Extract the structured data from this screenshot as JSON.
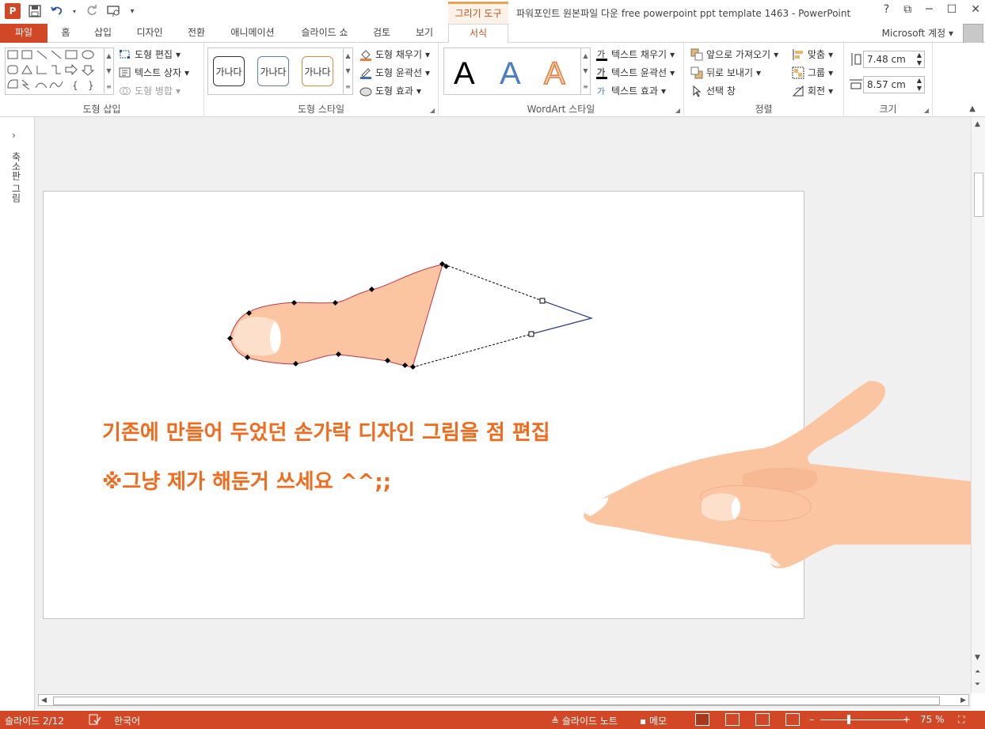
{
  "app": {
    "title": "파워포인트 원본파일 다운 free powerpoint ppt template 1463 - PowerPoint",
    "context_group": "그리기 도구",
    "account": "Microsoft 계정",
    "logo": "P",
    "accent_color": "#d24726"
  },
  "quick_access": [
    "save-icon",
    "undo-icon",
    "redo-icon",
    "present-icon",
    "customize-icon"
  ],
  "window_buttons": [
    "?",
    "⧉",
    "─",
    "☐",
    "✕"
  ],
  "tabs": [
    {
      "label": "파일"
    },
    {
      "label": "홈"
    },
    {
      "label": "삽입"
    },
    {
      "label": "디자인"
    },
    {
      "label": "전환"
    },
    {
      "label": "애니메이션"
    },
    {
      "label": "슬라이드 쇼"
    },
    {
      "label": "검토"
    },
    {
      "label": "보기"
    },
    {
      "label": "서식"
    }
  ],
  "ribbon": {
    "insert_shapes": {
      "label": "도형 삽입",
      "edit_shape": "도형 편집",
      "text_box": "텍스트 상자",
      "merge_shapes": "도형 병합"
    },
    "shape_styles": {
      "label": "도형 스타일",
      "preview": [
        "가나다",
        "가나다",
        "가나다"
      ],
      "fill": "도형 채우기",
      "outline": "도형 윤곽선",
      "effects": "도형 효과"
    },
    "wordart": {
      "label": "WordArt 스타일",
      "letters": [
        "A",
        "A",
        "A"
      ],
      "text_fill": "텍스트 채우기",
      "text_outline": "텍스트 윤곽선",
      "text_effects": "텍스트 효과"
    },
    "arrange": {
      "label": "정렬",
      "bring_forward": "앞으로 가져오기",
      "send_backward": "뒤로 보내기",
      "selection_pane": "선택 창",
      "align": "맞춤",
      "group": "그룹",
      "rotate": "회전"
    },
    "size": {
      "label": "크기",
      "height": "7.48 cm",
      "width": "8.57 cm"
    }
  },
  "left_pane": {
    "label": "축소판 그림"
  },
  "slide": {
    "line1": "기존에 만들어 두었던 손가락 디자인 그림을 점 편집",
    "line2": "※그냥 제가 해둔거 쓰세요 ^^;;",
    "text_color": "#f26a1b",
    "skin_color": "#fcc5a1"
  },
  "status": {
    "slide_info": "슬라이드 2/12",
    "language": "한국어",
    "notes": "슬라이드 노트",
    "comments": "메모",
    "zoom": "75 %"
  }
}
